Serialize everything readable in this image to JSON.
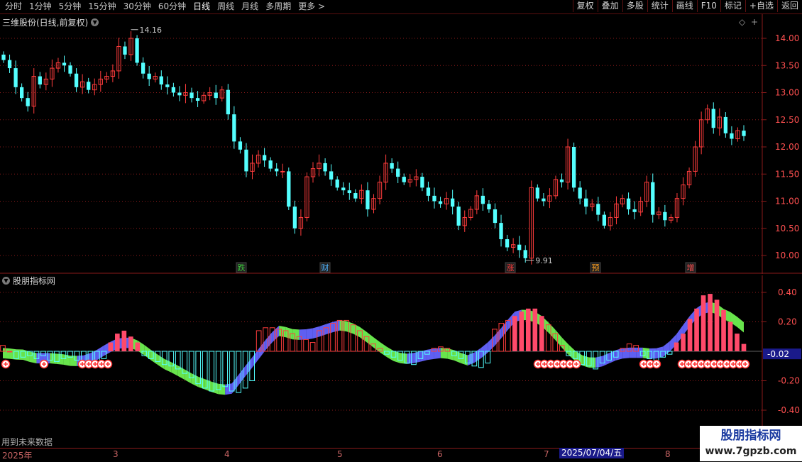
{
  "toolbar": {
    "periods": [
      "分时",
      "1分钟",
      "5分钟",
      "15分钟",
      "30分钟",
      "60分钟",
      "日线",
      "周线",
      "月线",
      "多周期",
      "更多 >"
    ],
    "active_period": "日线",
    "right_buttons": [
      "复权",
      "叠加",
      "多股",
      "统计",
      "画线",
      "F10",
      "标记",
      "+自选",
      "返回"
    ]
  },
  "main_chart": {
    "title": "三维股份(日线,前复权)",
    "high_label": "14.16",
    "low_label": "9.91",
    "price_axis": [
      "14.00",
      "13.50",
      "13.00",
      "12.50",
      "12.00",
      "11.50",
      "11.00",
      "10.50",
      "10.00"
    ],
    "markers": [
      {
        "text": "跌",
        "color": "#3cc83c"
      },
      {
        "text": "财",
        "color": "#50b4ff"
      },
      {
        "text": "涨",
        "color": "#ff3c3c"
      },
      {
        "text": "预",
        "color": "#ffa020"
      },
      {
        "text": "增",
        "color": "#ff5050"
      }
    ]
  },
  "indicator": {
    "title": "股朋指标网",
    "axis": [
      "0.40",
      "0.20",
      "-0.20",
      "-0.40"
    ],
    "current_value": "-0.02",
    "note": "用到未来数据"
  },
  "date_axis": {
    "year_label": "2025年",
    "months": [
      "3",
      "4",
      "5",
      "6",
      "7",
      "8"
    ],
    "cursor_date": "2025/07/04/五"
  },
  "watermark": {
    "title": "股朋指标网",
    "url": "www.7gpzb.com"
  },
  "colors": {
    "up": "#ff3c3c",
    "down": "#54ffff",
    "grid": "#8a1a1a",
    "ribbon_green": "#6ef050",
    "ribbon_blue": "#6464ff",
    "hist_pink": "#ff4a6a"
  },
  "chart_data": {
    "type": "candlestick",
    "price_range": [
      9.8,
      14.3
    ],
    "closes": [
      13.6,
      13.45,
      13.1,
      12.9,
      12.75,
      13.3,
      13.15,
      13.25,
      13.45,
      13.55,
      13.5,
      13.35,
      13.1,
      13.2,
      13.05,
      13.15,
      13.25,
      13.3,
      13.4,
      13.85,
      13.7,
      14.0,
      13.55,
      13.35,
      13.25,
      13.3,
      13.15,
      13.1,
      13.0,
      12.95,
      13.0,
      12.9,
      12.85,
      12.95,
      13.0,
      12.9,
      13.05,
      12.6,
      12.1,
      11.95,
      11.55,
      11.7,
      11.85,
      11.75,
      11.6,
      11.55,
      11.55,
      10.9,
      10.5,
      10.7,
      11.45,
      11.6,
      11.7,
      11.55,
      11.4,
      11.25,
      11.2,
      11.15,
      11.05,
      11.2,
      10.85,
      11.05,
      11.35,
      11.7,
      11.6,
      11.45,
      11.35,
      11.4,
      11.45,
      11.25,
      11.1,
      11.0,
      10.95,
      11.05,
      10.9,
      10.55,
      10.7,
      10.85,
      11.1,
      10.95,
      10.85,
      10.6,
      10.3,
      10.15,
      10.2,
      10.1,
      9.95,
      11.25,
      11.05,
      11.0,
      11.1,
      11.4,
      11.35,
      12.0,
      11.25,
      11.05,
      10.9,
      10.95,
      10.75,
      10.55,
      10.7,
      10.95,
      11.05,
      10.85,
      10.8,
      11.0,
      11.35,
      10.75,
      10.8,
      10.65,
      10.7,
      11.05,
      11.3,
      11.55,
      12.0,
      12.5,
      12.7,
      12.35,
      12.55,
      12.25,
      12.15,
      12.3,
      12.2
    ],
    "indicator_hist": [
      0.04,
      0.0,
      -0.05,
      -0.04,
      -0.03,
      -0.05,
      -0.03,
      -0.06,
      -0.07,
      -0.05,
      -0.04,
      -0.06,
      -0.08,
      -0.09,
      -0.07,
      -0.05,
      0.06,
      0.12,
      0.14,
      0.1,
      0.06,
      -0.03,
      -0.05,
      -0.07,
      -0.09,
      -0.1,
      -0.12,
      -0.15,
      -0.18,
      -0.22,
      -0.25,
      -0.27,
      -0.26,
      -0.24,
      -0.27,
      -0.28,
      -0.25,
      -0.2,
      0.14,
      0.16,
      0.16,
      0.15,
      0.14,
      0.12,
      0.1,
      0.08,
      0.06,
      0.14,
      0.16,
      0.19,
      0.21,
      0.21,
      0.18,
      0.14,
      0.1,
      0.05,
      0.02,
      -0.02,
      -0.04,
      -0.06,
      -0.08,
      -0.09,
      -0.05,
      -0.02,
      0.02,
      0.03,
      0.02,
      -0.03,
      -0.05,
      -0.08,
      -0.1,
      -0.11,
      -0.08,
      0.15,
      0.19,
      0.21,
      0.24,
      0.27,
      0.29,
      0.29,
      0.24,
      0.18,
      0.12,
      0.04,
      -0.03,
      -0.05,
      -0.09,
      -0.1,
      -0.12,
      -0.08,
      -0.06,
      -0.04,
      0.02,
      0.05,
      0.04,
      -0.03,
      -0.05,
      -0.06,
      -0.04,
      -0.02,
      0.06,
      0.12,
      0.22,
      0.29,
      0.38,
      0.39,
      0.35,
      0.28,
      0.2,
      0.12,
      0.05
    ]
  }
}
